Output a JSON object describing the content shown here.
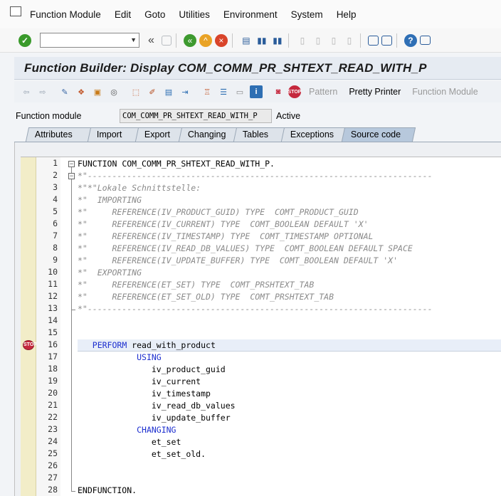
{
  "menu": {
    "items": [
      "Function Module",
      "Edit",
      "Goto",
      "Utilities",
      "Environment",
      "System",
      "Help"
    ]
  },
  "toolbar": {
    "command_value": "",
    "ok_icon": "enter-check-icon"
  },
  "title": "Function Builder: Display COM_COMM_PR_SHTEXT_READ_WITH_P",
  "app_toolbar": {
    "pattern_label": "Pattern",
    "pretty_printer_label": "Pretty Printer",
    "function_module_label": "Function Module"
  },
  "function_module": {
    "label": "Function module",
    "value": "COM_COMM_PR_SHTEXT_READ_WITH_P",
    "status": "Active"
  },
  "tabs": [
    {
      "label": "Attributes",
      "active": false
    },
    {
      "label": "Import",
      "active": false
    },
    {
      "label": "Export",
      "active": false
    },
    {
      "label": "Changing",
      "active": false
    },
    {
      "label": "Tables",
      "active": false
    },
    {
      "label": "Exceptions",
      "active": false
    },
    {
      "label": "Source code",
      "active": true
    }
  ],
  "code": {
    "current_line": 16,
    "breakpoint_line": 16,
    "lines": [
      {
        "n": "1",
        "parts": [
          [
            "kw2",
            "FUNCTION"
          ],
          [
            "tx",
            " COM_COMM_PR_SHTEXT_READ_WITH_P."
          ]
        ]
      },
      {
        "n": "2",
        "parts": [
          [
            "cm",
            "*\"----------------------------------------------------------------------"
          ]
        ]
      },
      {
        "n": "3",
        "parts": [
          [
            "cm",
            "*\"*\"Lokale Schnittstelle:"
          ]
        ]
      },
      {
        "n": "4",
        "parts": [
          [
            "cm",
            "*\"  IMPORTING"
          ]
        ]
      },
      {
        "n": "5",
        "parts": [
          [
            "cm",
            "*\"     REFERENCE(IV_PRODUCT_GUID) TYPE  COMT_PRODUCT_GUID"
          ]
        ]
      },
      {
        "n": "6",
        "parts": [
          [
            "cm",
            "*\"     REFERENCE(IV_CURRENT) TYPE  COMT_BOOLEAN DEFAULT 'X'"
          ]
        ]
      },
      {
        "n": "7",
        "parts": [
          [
            "cm",
            "*\"     REFERENCE(IV_TIMESTAMP) TYPE  COMT_TIMESTAMP OPTIONAL"
          ]
        ]
      },
      {
        "n": "8",
        "parts": [
          [
            "cm",
            "*\"     REFERENCE(IV_READ_DB_VALUES) TYPE  COMT_BOOLEAN DEFAULT SPACE"
          ]
        ]
      },
      {
        "n": "9",
        "parts": [
          [
            "cm",
            "*\"     REFERENCE(IV_UPDATE_BUFFER) TYPE  COMT_BOOLEAN DEFAULT 'X'"
          ]
        ]
      },
      {
        "n": "10",
        "parts": [
          [
            "cm",
            "*\"  EXPORTING"
          ]
        ]
      },
      {
        "n": "11",
        "parts": [
          [
            "cm",
            "*\"     REFERENCE(ET_SET) TYPE  COMT_PRSHTEXT_TAB"
          ]
        ]
      },
      {
        "n": "12",
        "parts": [
          [
            "cm",
            "*\"     REFERENCE(ET_SET_OLD) TYPE  COMT_PRSHTEXT_TAB"
          ]
        ]
      },
      {
        "n": "13",
        "parts": [
          [
            "cm",
            "*\"----------------------------------------------------------------------"
          ]
        ]
      },
      {
        "n": "14",
        "parts": []
      },
      {
        "n": "15",
        "parts": []
      },
      {
        "n": "16",
        "parts": [
          [
            "tx",
            "   "
          ],
          [
            "kw",
            "PERFORM"
          ],
          [
            "tx",
            " read_with_product"
          ]
        ]
      },
      {
        "n": "17",
        "parts": [
          [
            "tx",
            "            "
          ],
          [
            "kw",
            "USING"
          ]
        ]
      },
      {
        "n": "18",
        "parts": [
          [
            "tx",
            "               iv_product_guid"
          ]
        ]
      },
      {
        "n": "19",
        "parts": [
          [
            "tx",
            "               iv_current"
          ]
        ]
      },
      {
        "n": "20",
        "parts": [
          [
            "tx",
            "               iv_timestamp"
          ]
        ]
      },
      {
        "n": "21",
        "parts": [
          [
            "tx",
            "               iv_read_db_values"
          ]
        ]
      },
      {
        "n": "22",
        "parts": [
          [
            "tx",
            "               iv_update_buffer"
          ]
        ]
      },
      {
        "n": "23",
        "parts": [
          [
            "tx",
            "            "
          ],
          [
            "kw",
            "CHANGING"
          ]
        ]
      },
      {
        "n": "24",
        "parts": [
          [
            "tx",
            "               et_set"
          ]
        ]
      },
      {
        "n": "25",
        "parts": [
          [
            "tx",
            "               et_set_old."
          ]
        ]
      },
      {
        "n": "26",
        "parts": []
      },
      {
        "n": "27",
        "parts": []
      },
      {
        "n": "28",
        "parts": [
          [
            "kw2",
            "ENDFUNCTION"
          ],
          [
            "tx",
            "."
          ]
        ]
      }
    ]
  },
  "colors": {
    "keyword": "#1d2fcf",
    "comment": "#8a8a8a",
    "breakpoint": "#c5283d",
    "gutter": "#f2edc8"
  }
}
